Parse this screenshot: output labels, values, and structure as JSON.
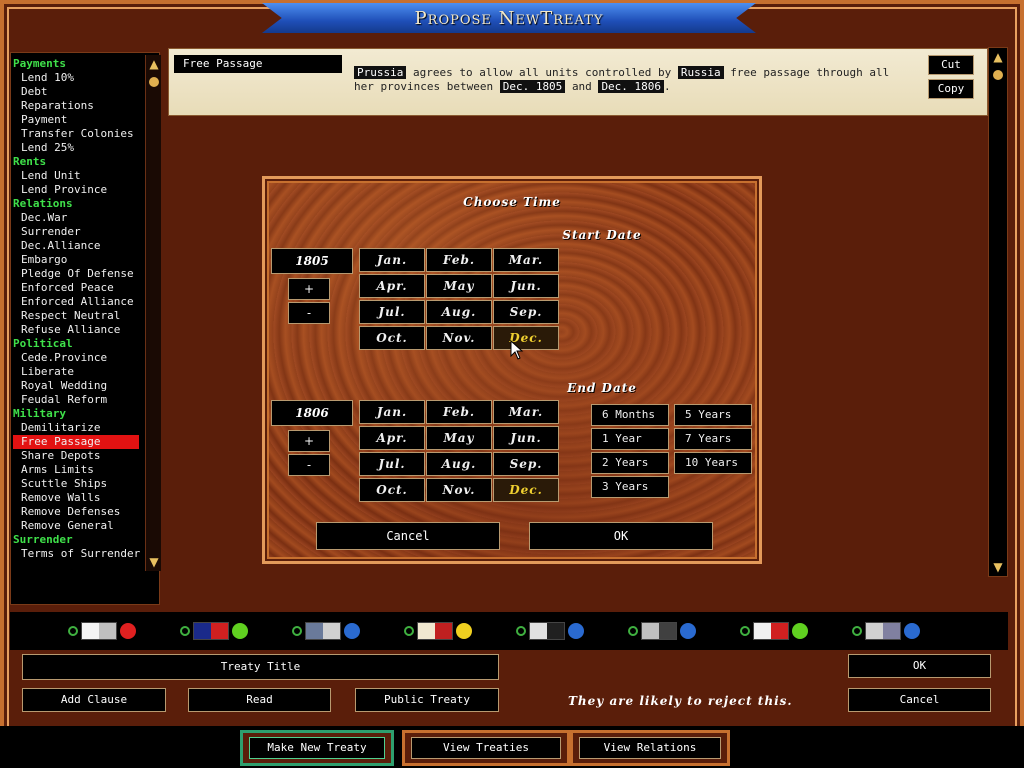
{
  "window": {
    "title": "Propose NewTreaty"
  },
  "clauses": [
    {
      "type": "cat",
      "label": "Payments"
    },
    {
      "type": "item",
      "label": "Lend 10%"
    },
    {
      "type": "item",
      "label": "Debt"
    },
    {
      "type": "item",
      "label": "Reparations"
    },
    {
      "type": "item",
      "label": "Payment"
    },
    {
      "type": "item",
      "label": "Transfer Colonies"
    },
    {
      "type": "item",
      "label": "Lend 25%"
    },
    {
      "type": "cat",
      "label": "Rents"
    },
    {
      "type": "item",
      "label": "Lend Unit"
    },
    {
      "type": "item",
      "label": "Lend Province"
    },
    {
      "type": "cat",
      "label": "Relations"
    },
    {
      "type": "item",
      "label": "Dec.War"
    },
    {
      "type": "item",
      "label": "Surrender"
    },
    {
      "type": "item",
      "label": "Dec.Alliance"
    },
    {
      "type": "item",
      "label": "Embargo"
    },
    {
      "type": "item",
      "label": "Pledge Of Defense"
    },
    {
      "type": "item",
      "label": "Enforced Peace"
    },
    {
      "type": "item",
      "label": "Enforced Alliance"
    },
    {
      "type": "item",
      "label": "Respect Neutral"
    },
    {
      "type": "item",
      "label": "Refuse Alliance"
    },
    {
      "type": "cat",
      "label": "Political"
    },
    {
      "type": "item",
      "label": "Cede.Province"
    },
    {
      "type": "item",
      "label": "Liberate"
    },
    {
      "type": "item",
      "label": "Royal Wedding"
    },
    {
      "type": "item",
      "label": "Feudal Reform"
    },
    {
      "type": "cat",
      "label": "Military"
    },
    {
      "type": "item",
      "label": "Demilitarize"
    },
    {
      "type": "item",
      "label": "Free Passage",
      "selected": true
    },
    {
      "type": "item",
      "label": "Share Depots"
    },
    {
      "type": "item",
      "label": "Arms Limits"
    },
    {
      "type": "item",
      "label": "Scuttle Ships"
    },
    {
      "type": "item",
      "label": "Remove Walls"
    },
    {
      "type": "item",
      "label": "Remove Defenses"
    },
    {
      "type": "item",
      "label": "Remove General"
    },
    {
      "type": "cat",
      "label": "Surrender"
    },
    {
      "type": "item",
      "label": "Terms of Surrender"
    }
  ],
  "description": {
    "clause_name": "Free Passage",
    "nation1": "Prussia",
    "text1": "agrees to allow all units controlled by",
    "nation2": "Russia",
    "text2": "free passage through all",
    "text3": "her provinces between",
    "start": "Dec. 1805",
    "and": "and",
    "end": "Dec. 1806",
    "period": ".",
    "cut_label": "Cut",
    "copy_label": "Copy"
  },
  "dialog": {
    "title": "Choose Time",
    "start_title": "Start Date",
    "end_title": "End Date",
    "start_year": "1805",
    "end_year": "1806",
    "plus": "+",
    "minus": "-",
    "months": [
      "Jan.",
      "Feb.",
      "Mar.",
      "Apr.",
      "May",
      "Jun.",
      "Jul.",
      "Aug.",
      "Sep.",
      "Oct.",
      "Nov.",
      "Dec."
    ],
    "start_selected_month": "Dec.",
    "end_selected_month": "Dec.",
    "durations_left": [
      "6 Months",
      "1 Year",
      "2 Years",
      "3 Years"
    ],
    "durations_right": [
      "5 Years",
      "7 Years",
      "10 Years"
    ],
    "cancel_label": "Cancel",
    "ok_label": "OK"
  },
  "nations": [
    {
      "flag": "#f4f4f4",
      "flag2": "#c0c0c0",
      "mood": "#e02020"
    },
    {
      "flag": "#1a2a8a",
      "flag2": "#d02020",
      "mood": "#60d020"
    },
    {
      "flag": "#6a7a9a",
      "flag2": "#d0d0d0",
      "mood": "#2a6ad0"
    },
    {
      "flag": "#f0e8d0",
      "flag2": "#c02020",
      "mood": "#f0d020"
    },
    {
      "flag": "#e0e0e0",
      "flag2": "#202020",
      "mood": "#2a6ad0"
    },
    {
      "flag": "#c0c0c0",
      "flag2": "#404040",
      "mood": "#2a6ad0"
    },
    {
      "flag": "#f0f0f0",
      "flag2": "#d02020",
      "mood": "#60d020"
    },
    {
      "flag": "#d0d0d0",
      "flag2": "#8080a0",
      "mood": "#2a6ad0"
    }
  ],
  "controls": {
    "treaty_title": "Treaty Title",
    "add_clause": "Add Clause",
    "read": "Read",
    "public_treaty": "Public Treaty",
    "reject_msg": "They are likely to reject this.",
    "ok": "OK",
    "cancel": "Cancel"
  },
  "tabs": {
    "make_new": "Make New Treaty",
    "view_treaties": "View Treaties",
    "view_relations": "View Relations"
  }
}
